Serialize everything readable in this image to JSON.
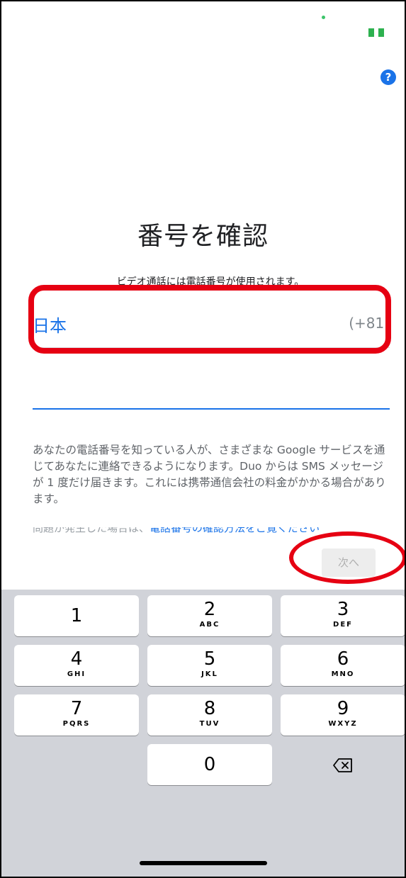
{
  "header": {
    "title": "番号を確認",
    "subtitle": "ビデオ通話には電話番号が使用されます。",
    "help_icon": "?"
  },
  "country": {
    "name": "日本",
    "code": "(+81)"
  },
  "phone": {
    "value": ""
  },
  "disclaimer": {
    "text": "あなたの電話番号を知っている人が、さまざまな Google サービスを通じてあなたに連絡できるようになります。Duo からは SMS メッセージが 1 度だけ届きます。これには携帯通信会社の料金がかかる場合があります。",
    "partial_prefix": "問題が発生した場合は、",
    "partial_link": "電話番号の確認方法をご覧ください"
  },
  "next_button": {
    "label": "次へ"
  },
  "keypad": {
    "keys": [
      {
        "digit": "1",
        "letters": ""
      },
      {
        "digit": "2",
        "letters": "ABC"
      },
      {
        "digit": "3",
        "letters": "DEF"
      },
      {
        "digit": "4",
        "letters": "GHI"
      },
      {
        "digit": "5",
        "letters": "JKL"
      },
      {
        "digit": "6",
        "letters": "MNO"
      },
      {
        "digit": "7",
        "letters": "PQRS"
      },
      {
        "digit": "8",
        "letters": "TUV"
      },
      {
        "digit": "9",
        "letters": "WXYZ"
      },
      {
        "digit": "0",
        "letters": ""
      }
    ],
    "delete_icon": "backspace-icon"
  },
  "colors": {
    "accent": "#1a73e8",
    "highlight": "#e60012",
    "keyboard_bg": "#d1d3d9"
  }
}
